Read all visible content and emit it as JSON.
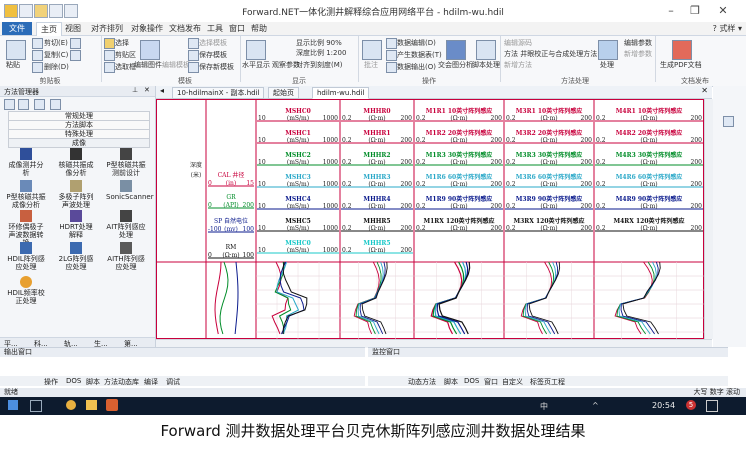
{
  "window": {
    "title": "Forward.NET一体化测井解释综合应用网络平台 - hdilm-wu.hdil",
    "style_label": "式样"
  },
  "menu": [
    "文件",
    "主页",
    "视图",
    "对齐排列",
    "对象操作",
    "文档发布",
    "工具",
    "窗口",
    "帮助"
  ],
  "ribbon": {
    "clipboard": {
      "paste": "粘贴",
      "cut": "剪切(E)",
      "copy": "复制(C)",
      "delete": "删除(D)",
      "label": "剪贴板"
    },
    "select": {
      "select": "选择",
      "clipboard_area": "剪贴区",
      "select_all": "选取框"
    },
    "edit": {
      "edit_template": "编辑图件",
      "edit_template2": "编辑模板",
      "select_template": "选择模板",
      "save_template": "保存模板",
      "save_as_template": "保存新模板",
      "label": "模板"
    },
    "display": {
      "ratio": "显示比例 90%",
      "depth_ratio": "深度比例 1:200",
      "to_scale": "对齐到刻度(M)",
      "horizontal": "水平显示",
      "observe": "观察参数",
      "label": "显示"
    },
    "ops": {
      "annotate": "批注",
      "object_op": "对象",
      "new_doc": "数据编辑(D)",
      "product_data": "产生数据表(T)",
      "data_out": "数据输出(O)",
      "text_analysis": "交会图分析",
      "script": "脚本处理",
      "label": "操作"
    },
    "method": {
      "manage": "编辑源码",
      "flow": "方法 井眼校正与合成处理方法",
      "new_proc": "新增方法",
      "fix": "处理",
      "params": "编辑参数",
      "new_params": "新增参数",
      "label": "方法处理"
    },
    "publish": {
      "gen_pdf": "生成PDF文档",
      "label": "文档发布"
    }
  },
  "left_panel": {
    "title": "方法管理器",
    "categories": [
      "常规处理",
      "方法脚本",
      "特殊处理",
      "成像"
    ],
    "modules": [
      [
        "成像测井分析",
        "核磁共振成像分析",
        "P型核磁共振测前设计"
      ],
      [
        "P型核磁共振成像分析",
        "多极子阵列声波处理",
        "SonicScanner"
      ],
      [
        "环修偶极子声波数据转换",
        "HDRT处理解释",
        "AIT阵列感应处理"
      ],
      [
        "HDIL阵列感应处理",
        "2LG阵列感应处理",
        "AITH阵列感应处理"
      ],
      [
        "HDIL频率校正处理"
      ]
    ],
    "bottom_tabs": [
      "平...",
      "科...",
      "轨...",
      "生...",
      "第..."
    ]
  },
  "doc_tabs": [
    "10-hdilmainX - 副本.hdil",
    "起始页",
    "hdilm-wu.hdil"
  ],
  "plot": {
    "left_labels": {
      "depth": "深度",
      "depth_unit": "(米)",
      "cal": "CAL 井径",
      "cal_unit": "(in)",
      "cal_range": [
        "0",
        "15"
      ],
      "gr": "GR",
      "gr_unit": "(API)",
      "gr_range": [
        "0",
        "200"
      ],
      "sp": "SP 自然电位",
      "sp_unit": "(mv)",
      "sp_range": [
        "-100",
        "100"
      ],
      "rm": "RM",
      "rm_unit": "(Ω·m)",
      "rm_range": [
        "0",
        "100"
      ]
    },
    "tracks": [
      {
        "rows": [
          {
            "name": "MSHC0",
            "unit": "(mS/m)",
            "range": [
              "10",
              "1000"
            ]
          },
          {
            "name": "MSHC1",
            "unit": "(mS/m)",
            "range": [
              "10",
              "1000"
            ]
          },
          {
            "name": "MSHC2",
            "unit": "(mS/m)",
            "range": [
              "10",
              "1000"
            ]
          },
          {
            "name": "MSHC3",
            "unit": "(mS/m)",
            "range": [
              "10",
              "1000"
            ]
          },
          {
            "name": "MSHC4",
            "unit": "(mS/m)",
            "range": [
              "10",
              "1000"
            ]
          },
          {
            "name": "MSHC5",
            "unit": "(mS/m)",
            "range": [
              "10",
              "1000"
            ]
          },
          {
            "name": "MSHC0",
            "unit": "(mS/m)",
            "range": [
              "10",
              "1000"
            ]
          }
        ]
      },
      {
        "rows": [
          {
            "name": "MHHR0",
            "unit": "(Ω·m)",
            "range": [
              "0.2",
              "200"
            ]
          },
          {
            "name": "MHHR1",
            "unit": "(Ω·m)",
            "range": [
              "0.2",
              "200"
            ]
          },
          {
            "name": "MHHR2",
            "unit": "(Ω·m)",
            "range": [
              "0.2",
              "200"
            ]
          },
          {
            "name": "MHHR3",
            "unit": "(Ω·m)",
            "range": [
              "0.2",
              "200"
            ]
          },
          {
            "name": "MHHR4",
            "unit": "(Ω·m)",
            "range": [
              "0.2",
              "200"
            ]
          },
          {
            "name": "MHHR5",
            "unit": "(Ω·m)",
            "range": [
              "0.2",
              "200"
            ]
          },
          {
            "name": "MHHR5",
            "unit": "(Ω·m)",
            "range": [
              "0.2",
              "200"
            ]
          }
        ]
      },
      {
        "rows": [
          {
            "name": "M1R1 10英寸阵列感应",
            "unit": "(Ω·m)",
            "range": [
              "0.2",
              "200"
            ]
          },
          {
            "name": "M1R2 20英寸阵列感应",
            "unit": "(Ω·m)",
            "range": [
              "0.2",
              "200"
            ]
          },
          {
            "name": "M1R3 30英寸阵列感应",
            "unit": "(Ω·m)",
            "range": [
              "0.2",
              "200"
            ]
          },
          {
            "name": "M1R6 60英寸阵列感应",
            "unit": "(Ω·m)",
            "range": [
              "0.2",
              "200"
            ]
          },
          {
            "name": "M1R9 90英寸阵列感应",
            "unit": "(Ω·m)",
            "range": [
              "0.2",
              "200"
            ]
          },
          {
            "name": "M1RX 120英寸阵列感应",
            "unit": "(Ω·m)",
            "range": [
              "0.2",
              "200"
            ]
          }
        ]
      },
      {
        "rows": [
          {
            "name": "M3R1 10英寸阵列感应",
            "unit": "(Ω·m)",
            "range": [
              "0.2",
              "200"
            ]
          },
          {
            "name": "M3R2 20英寸阵列感应",
            "unit": "(Ω·m)",
            "range": [
              "0.2",
              "200"
            ]
          },
          {
            "name": "M3R3 30英寸阵列感应",
            "unit": "(Ω·m)",
            "range": [
              "0.2",
              "200"
            ]
          },
          {
            "name": "M3R6 60英寸阵列感应",
            "unit": "(Ω·m)",
            "range": [
              "0.2",
              "200"
            ]
          },
          {
            "name": "M3R9 90英寸阵列感应",
            "unit": "(Ω·m)",
            "range": [
              "0.2",
              "200"
            ]
          },
          {
            "name": "M3RX 120英寸阵列感应",
            "unit": "(Ω·m)",
            "range": [
              "0.2",
              "200"
            ]
          }
        ]
      },
      {
        "rows": [
          {
            "name": "M4R1 10英寸阵列感应",
            "unit": "(Ω·m)",
            "range": [
              "0.2",
              "200"
            ]
          },
          {
            "name": "M4R2 20英寸阵列感应",
            "unit": "(Ω·m)",
            "range": [
              "0.2",
              "200"
            ]
          },
          {
            "name": "M4R3 30英寸阵列感应",
            "unit": "(Ω·m)",
            "range": [
              "0.2",
              "200"
            ]
          },
          {
            "name": "M4R6 60英寸阵列感应",
            "unit": "(Ω·m)",
            "range": [
              "0.2",
              "200"
            ]
          },
          {
            "name": "M4R9 90英寸阵列感应",
            "unit": "(Ω·m)",
            "range": [
              "0.2",
              "200"
            ]
          },
          {
            "name": "M4RX 120英寸阵列感应",
            "unit": "(Ω·m)",
            "range": [
              "0.2",
              "200"
            ]
          }
        ]
      }
    ],
    "row_colors": [
      "#c8003c",
      "#c8003c",
      "#008c28",
      "#2aa8c8",
      "#0a1a8c",
      "#111111",
      "#18c8c8"
    ]
  },
  "output_pane": {
    "title": "输出窗口",
    "tabs": [
      "操作",
      "DOS",
      "脚本",
      "方法动态库",
      "编译",
      "调试"
    ]
  },
  "change_pane": {
    "title": "监控窗口",
    "tabs": [
      "动态方法",
      "脚本",
      "DOS",
      "窗口",
      "自定义",
      "标签页工程"
    ]
  },
  "status": {
    "left": "就绪",
    "right": "大写 数字 滚动"
  },
  "taskbar": {
    "time": "20:54",
    "ime": "中",
    "date_day": "5"
  },
  "caption": "Forward 测井数据处理平台贝克休斯阵列感应测井数据处理结果"
}
